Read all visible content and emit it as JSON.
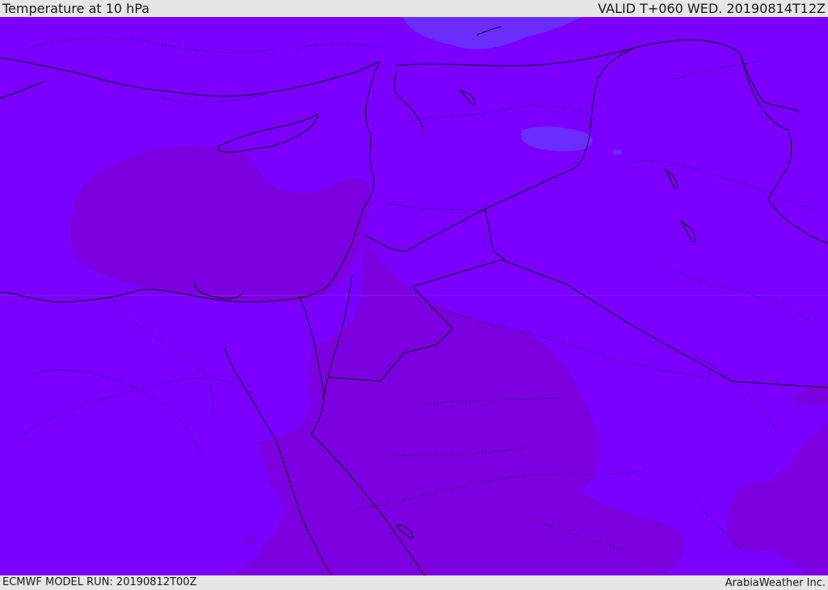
{
  "header": {
    "title": "Temperature at 10 hPa",
    "valid": "VALID T+060 WED. 20190814T12Z"
  },
  "footer": {
    "model_run": "ECMWF MODEL RUN: 20190812T00Z",
    "credit": "ArabiaWeather Inc."
  },
  "colors": {
    "base_field": "#7b00ff",
    "warm_field": "#7d00e0",
    "cool_field": "#6b22ff",
    "coastline": "#111111",
    "borders": "#222222"
  }
}
